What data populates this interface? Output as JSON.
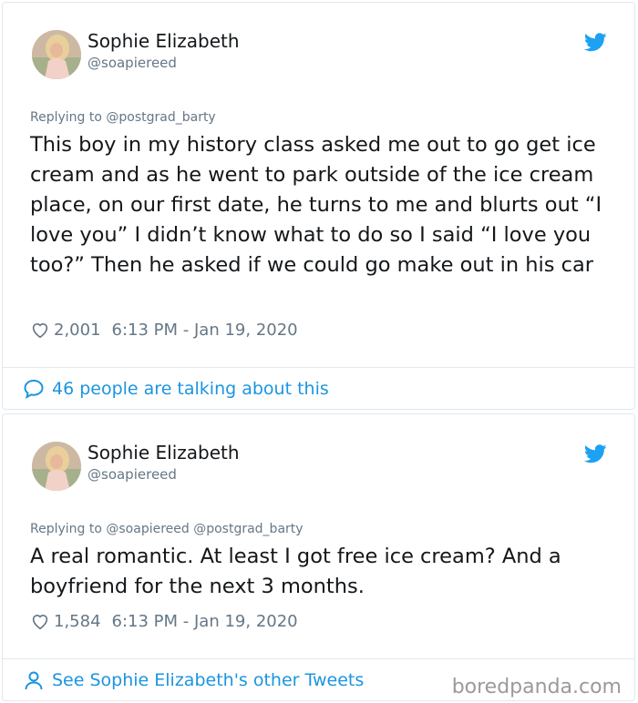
{
  "tweets": [
    {
      "author_name": "Sophie Elizabeth",
      "author_handle": "@soapiereed",
      "replying_to": "Replying to @postgrad_barty",
      "text": "This boy in my history class asked me out to go get ice cream and as he went to park outside of the ice cream place, on our first date, he turns to me and blurts out “I love you” I didn’t know what to do so I said “I love you too?” Then he asked if we could go make out in his car",
      "likes": "2,001",
      "timestamp": "6:13 PM - Jan 19, 2020",
      "footer_link": "46 people are talking about this"
    },
    {
      "author_name": "Sophie Elizabeth",
      "author_handle": "@soapiereed",
      "replying_to": "Replying to @soapiereed @postgrad_barty",
      "text": "A real romantic. At least I got free ice cream? And a boyfriend for the next 3 months.",
      "likes": "1,584",
      "timestamp": "6:13 PM - Jan 19, 2020",
      "footer_link": "See Sophie Elizabeth's other Tweets"
    }
  ],
  "watermark": "boredpanda.com",
  "colors": {
    "link": "#1b95e0",
    "twitter_blue": "#1da1f2",
    "muted": "#657786",
    "border": "#e1e8ed"
  },
  "icons": {
    "bird": "twitter-bird-icon",
    "like": "heart-icon",
    "talk": "speech-bubble-icon",
    "profile": "person-icon"
  }
}
